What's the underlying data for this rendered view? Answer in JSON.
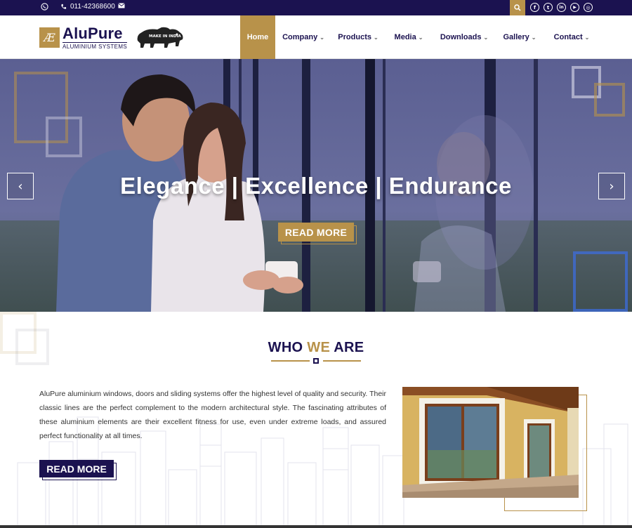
{
  "topbar": {
    "phone": "011-42368600",
    "icons": [
      "whatsapp-icon",
      "phone-icon",
      "envelope-icon",
      "search-icon",
      "facebook-icon",
      "twitter-icon",
      "linkedin-icon",
      "youtube-icon",
      "instagram-icon"
    ],
    "social_glyphs": [
      "f",
      "t",
      "in",
      "▶",
      "◎"
    ]
  },
  "header": {
    "logo_mark": "Æ",
    "logo_name": "AluPure",
    "logo_sub": "ALUMINIUM SYSTEMS",
    "badge_text": "MAKE IN INDIA",
    "nav": [
      {
        "label": "Home",
        "active": true
      },
      {
        "label": "Company",
        "active": false
      },
      {
        "label": "Products",
        "active": false
      },
      {
        "label": "Media",
        "active": false
      },
      {
        "label": "Downloads",
        "active": false
      },
      {
        "label": "Gallery",
        "active": false
      },
      {
        "label": "Contact",
        "active": false
      }
    ]
  },
  "hero": {
    "title": "Elegance | Excellence | Endurance",
    "button": "READ MORE",
    "prev_glyph": "‹",
    "next_glyph": "›"
  },
  "about": {
    "title_a": "WHO ",
    "title_b": "WE",
    "title_c": " ARE",
    "text": "AluPure aluminium windows, doors and sliding systems offer the highest level of quality and security. Their classic lines are the perfect complement to the modern architectural style. The fascinating attributes of these aluminium elements are their excellent fitness for use, even under extreme loads, and assured perfect functionality at all times.",
    "button": "READ MORE"
  },
  "colors": {
    "navy": "#1b1250",
    "gold": "#b8924a"
  }
}
